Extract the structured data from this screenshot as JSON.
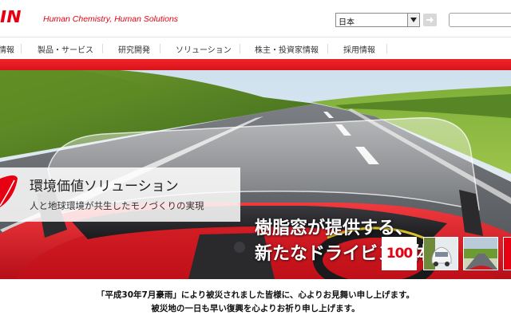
{
  "header": {
    "logo_text": "JIN",
    "tagline": "Human Chemistry, Human Solutions",
    "language": {
      "selected": "日本"
    },
    "search": {
      "value": "",
      "placeholder": ""
    }
  },
  "nav": {
    "items": [
      {
        "label": "情報"
      },
      {
        "label": "製品・サービス"
      },
      {
        "label": "研究開発"
      },
      {
        "label": "ソリューション"
      },
      {
        "label": "株主・投資家情報"
      },
      {
        "label": "採用情報"
      }
    ]
  },
  "hero": {
    "title": "環境価値ソリューション",
    "subtitle": "人と地球環境が共生したモノづくりの実現",
    "headline_line1": "樹脂窓が提供する、",
    "headline_line2": "新たなドライビング体験",
    "thumbnails": [
      {
        "label": "100"
      }
    ]
  },
  "notice": {
    "line1": "「平成30年7月豪雨」により被災されました皆様に、心よりお見舞い申し上げます。",
    "line2": "被災地の一日も早い復興を心よりお祈り申し上げます。"
  },
  "colors": {
    "brand_red": "#e60012",
    "nav_bar_red": "#e8161d"
  }
}
